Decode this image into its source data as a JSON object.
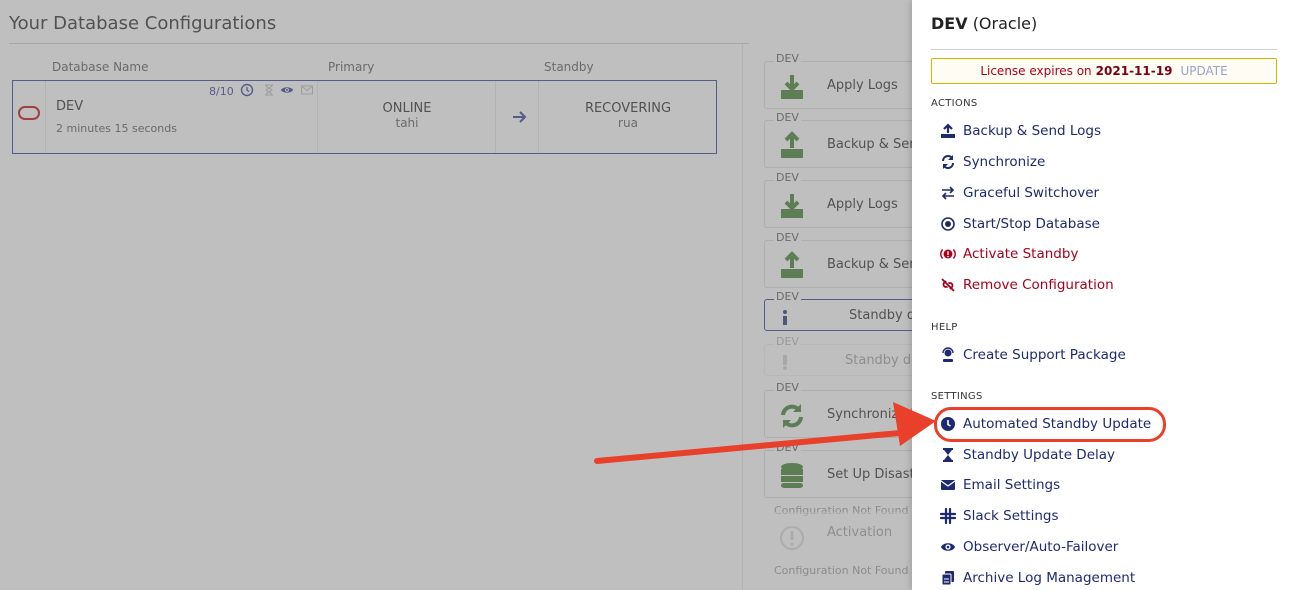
{
  "main": {
    "title": "Your Database Configurations",
    "columns": {
      "name": "Database Name",
      "primary": "Primary",
      "standby": "Standby"
    },
    "database": {
      "name": "DEV",
      "age": "2 minutes 15 seconds",
      "score": "8/10",
      "primary_status": "ONLINE",
      "primary_host": "tahi",
      "standby_status": "RECOVERING",
      "standby_host": "rua"
    }
  },
  "activity": {
    "items": [
      {
        "tag": "DEV",
        "label": "Apply Logs",
        "icon": "download-icon"
      },
      {
        "tag": "DEV",
        "label": "Backup & Sen",
        "icon": "upload-icon"
      },
      {
        "tag": "DEV",
        "label": "Apply Logs",
        "icon": "download-icon"
      },
      {
        "tag": "DEV",
        "label": "Backup & Sen",
        "icon": "upload-icon"
      },
      {
        "tag": "DEV",
        "label": "Standby d",
        "icon": "info-icon"
      },
      {
        "tag": "DEV",
        "label": "Standby de",
        "icon": "alert-icon"
      },
      {
        "tag": "DEV",
        "label": "Synchronize D",
        "icon": "sync-icon"
      },
      {
        "tag": "DEV",
        "label": "Set Up Disast",
        "icon": "database-icon"
      },
      {
        "tag": "Configuration Not Found",
        "label": "Activation",
        "icon": "alert-icon"
      },
      {
        "tag": "Configuration Not Found",
        "label": "",
        "icon": ""
      }
    ]
  },
  "panel": {
    "title": "DEV",
    "subtitle": "(Oracle)",
    "license_text": "License expires on",
    "license_date": "2021-11-19",
    "license_action": "UPDATE",
    "sections": {
      "actions": "ACTIONS",
      "help": "HELP",
      "settings": "SETTINGS"
    },
    "actions": [
      {
        "label": "Backup & Send Logs",
        "icon": "upload-icon"
      },
      {
        "label": "Synchronize",
        "icon": "sync-icon"
      },
      {
        "label": "Graceful Switchover",
        "icon": "switch-icon"
      },
      {
        "label": "Start/Stop Database",
        "icon": "power-icon"
      },
      {
        "label": "Activate Standby",
        "icon": "alert-icon"
      },
      {
        "label": "Remove Configuration",
        "icon": "unlink-icon"
      }
    ],
    "help": [
      {
        "label": "Create Support Package",
        "icon": "support-icon"
      }
    ],
    "settings": [
      {
        "label": "Automated Standby Update",
        "icon": "clock-icon"
      },
      {
        "label": "Standby Update Delay",
        "icon": "hourglass-icon"
      },
      {
        "label": "Email Settings",
        "icon": "envelope-icon"
      },
      {
        "label": "Slack Settings",
        "icon": "slack-icon"
      },
      {
        "label": "Observer/Auto-Failover",
        "icon": "eye-icon"
      },
      {
        "label": "Archive Log Management",
        "icon": "copy-icon"
      }
    ]
  },
  "colors": {
    "accent": "#1e2a6e",
    "danger": "#a8001c",
    "highlight": "#e8402a",
    "license_border": "#e0b000"
  }
}
